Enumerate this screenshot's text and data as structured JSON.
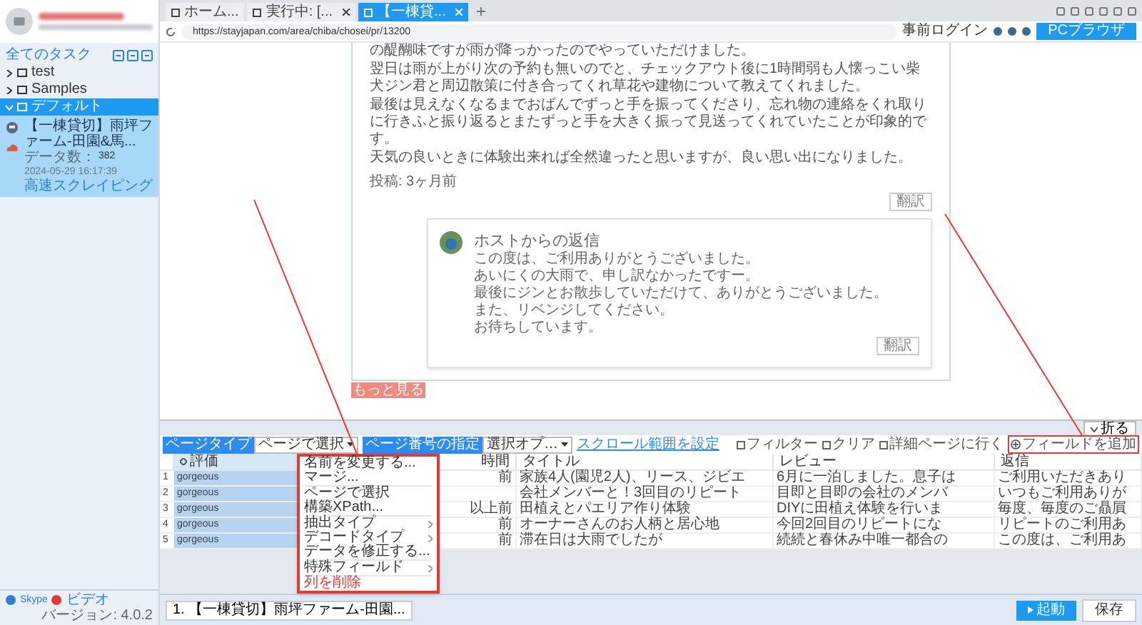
{
  "sidebar": {
    "all_tasks": "全てのタスク",
    "tree": [
      {
        "label": "test",
        "expanded": false,
        "selected": false
      },
      {
        "label": "Samples",
        "expanded": false,
        "selected": false
      },
      {
        "label": "デフォルト",
        "expanded": true,
        "selected": true,
        "children": [
          {
            "title": "【一棟貸切】雨坪ファーム-田園&馬...",
            "count_label": "データ数：",
            "count": "382",
            "time": "2024-05-29 16:17:39",
            "link": "高速スクレイピング"
          }
        ]
      }
    ],
    "footer": {
      "skype": "Skype",
      "video": "ビデオ",
      "version": "バージョン: 4.0.2"
    }
  },
  "browser": {
    "tabs": [
      {
        "label": "ホーム...",
        "selected": false,
        "closable": false
      },
      {
        "label": "実行中: [...",
        "selected": false,
        "closable": true
      },
      {
        "label": "【一棟貸...",
        "selected": true,
        "closable": true
      }
    ],
    "url": "https://stayjapan.com/area/chiba/chosei/pr/13200",
    "login": "事前ログイン",
    "mode": "PCブラウザ"
  },
  "review": {
    "lines": [
      "の醍醐味ですが雨が降っかったのでやっていただけました。",
      "翌日は雨が上がり次の予約も無いのでと、チェックアウト後に1時間弱も人懐っこい柴犬ジン君と周辺散策に付き合ってくれ草花や建物について教えてくれました。",
      "最後は見えなくなるまでおばんでずっと手を振ってくださり、忘れ物の連絡をくれ取りに行きふと振り返るとまたずっと手を大きく振って見送ってくれていたことが印象的です。",
      "天気の良いときに体験出来れば全然違ったと思いますが、良い思い出になりました。"
    ],
    "posted": "投稿: 3ヶ月前",
    "translate": "翻訳",
    "reply": {
      "title": "ホストからの返信",
      "lines": [
        "この度は、ご利用ありがとうございました。",
        "あいにくの大雨で、申し訳なかったですー。",
        "最後にジンとお散歩していただけて、ありがとうございました。",
        "また、リベンジしてください。",
        "お待ちしています。"
      ],
      "translate": "翻訳"
    },
    "more": "もっと見る"
  },
  "panel": {
    "collapse": "折る",
    "toolbar": {
      "page_type": "ページタイプ",
      "page_type_value": "ページで選択",
      "page_number": "ページ番号の指定",
      "page_number_value": "選択オプ…",
      "scroll_link": "スクロール範囲を設定",
      "filter": "フィルター",
      "clear": "クリア",
      "detail": "詳細ページに行く",
      "add_field": "フィールドを追加"
    },
    "table": {
      "columns": [
        {
          "label": "評価",
          "selected": true
        },
        {
          "label": "時間",
          "selected": false
        },
        {
          "label": "タイトル",
          "selected": false
        },
        {
          "label": "レビュー",
          "selected": false
        },
        {
          "label": "返信",
          "selected": false
        }
      ],
      "rows": [
        {
          "number": "1",
          "cells": [
            "gorgeous",
            "前",
            "家族4人(園児2人)、リース、ジビエ",
            "6月に一泊しました。息子は",
            "ご利用いただきあり"
          ]
        },
        {
          "number": "2",
          "cells": [
            "gorgeous",
            "",
            "会社メンバーと！3回目のリピート",
            "目即と目即の会社のメンバ",
            "いつもご利用ありが"
          ]
        },
        {
          "number": "3",
          "cells": [
            "gorgeous",
            "以上前",
            "田植えとパエリア作り体験",
            "DIYに田植え体験を行いま",
            "毎度、毎度のご贔屓"
          ]
        },
        {
          "number": "4",
          "cells": [
            "gorgeous",
            "前",
            "オーナーさんのお人柄と居心地",
            "今回2回目のリピートにな",
            "リピートのご利用あ"
          ]
        },
        {
          "number": "5",
          "cells": [
            "gorgeous",
            "前",
            "滞在日は大雨でしたが",
            "続続と春休み中唯一都合の",
            "この度は、ご利用あ"
          ]
        }
      ]
    },
    "context_menu": [
      [
        {
          "label": "名前を変更する...",
          "kind": "item"
        },
        {
          "label": "マージ...",
          "kind": "item"
        }
      ],
      [
        {
          "label": "ページで選択",
          "kind": "item"
        },
        {
          "label": "構築XPath...",
          "kind": "item"
        }
      ],
      [
        {
          "label": "抽出タイプ",
          "kind": "submenu"
        },
        {
          "label": "デコードタイプ",
          "kind": "submenu"
        },
        {
          "label": "データを修正する...",
          "kind": "item"
        }
      ],
      [
        {
          "label": "特殊フィールド",
          "kind": "submenu"
        }
      ],
      [
        {
          "label": "列を削除",
          "kind": "danger"
        }
      ]
    ]
  },
  "taskbar": {
    "task": "1. 【一棟貸切】雨坪ファーム-田園...",
    "start": "起動",
    "save": "保存"
  }
}
